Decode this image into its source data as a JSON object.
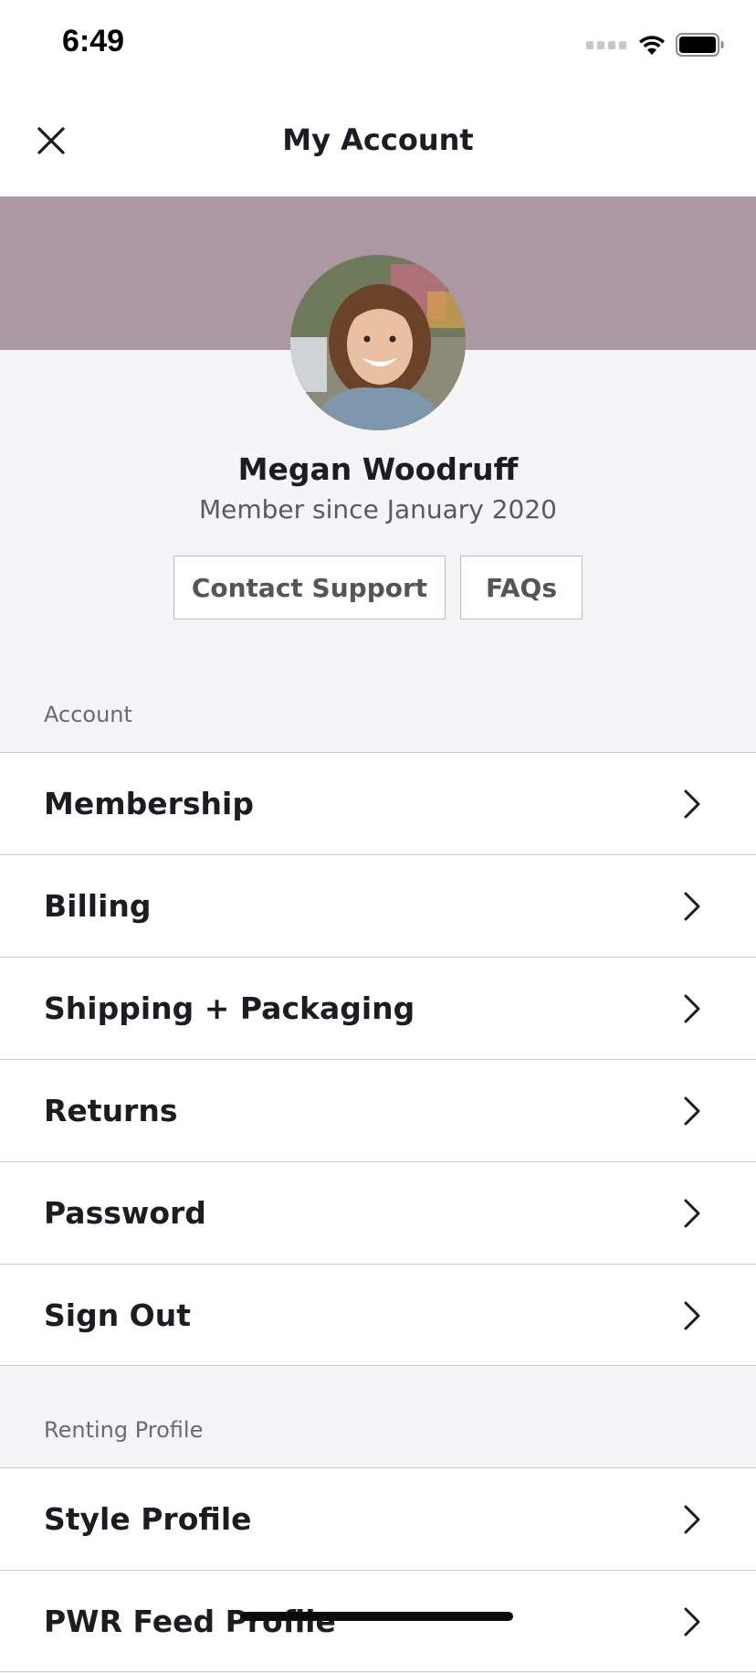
{
  "status_bar": {
    "time": "6:49"
  },
  "nav": {
    "title": "My Account"
  },
  "profile": {
    "name": "Megan Woodruff",
    "member_since": "Member since January 2020",
    "contact_support_label": "Contact Support",
    "faqs_label": "FAQs"
  },
  "account_section": {
    "label": "Account",
    "items": [
      {
        "label": "Membership"
      },
      {
        "label": "Billing"
      },
      {
        "label": "Shipping + Packaging"
      },
      {
        "label": "Returns"
      },
      {
        "label": "Password"
      },
      {
        "label": "Sign Out"
      }
    ]
  },
  "renting_section": {
    "label": "Renting Profile",
    "items": [
      {
        "label": "Style Profile"
      },
      {
        "label": "PWR Feed Profile"
      }
    ]
  },
  "colors": {
    "header_band": "#ab98a2",
    "page_background": "#f5f4f7",
    "text_primary": "#1d1c22"
  },
  "icons": [
    "close-icon",
    "chevron-right-icon",
    "signal-icon",
    "wifi-icon",
    "battery-icon"
  ]
}
